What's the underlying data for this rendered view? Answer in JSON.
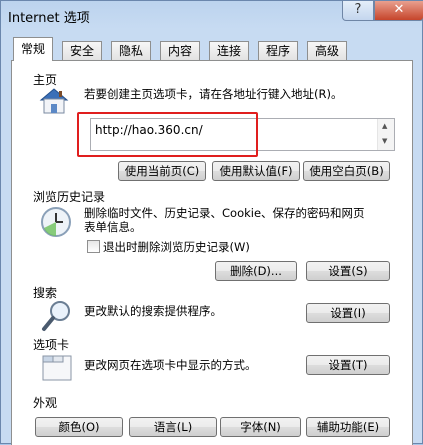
{
  "window": {
    "title": "Internet 选项",
    "help_label": "?",
    "close_label": "✕"
  },
  "tabs": [
    {
      "label": "常规",
      "active": true
    },
    {
      "label": "安全"
    },
    {
      "label": "隐私"
    },
    {
      "label": "内容"
    },
    {
      "label": "连接"
    },
    {
      "label": "程序"
    },
    {
      "label": "高级"
    }
  ],
  "homepage": {
    "title": "主页",
    "description": "若要创建主页选项卡，请在各地址行键入地址(R)。",
    "url_value": "http://hao.360.cn/",
    "use_current_label": "使用当前页(C)",
    "use_default_label": "使用默认值(F)",
    "use_blank_label": "使用空白页(B)"
  },
  "history": {
    "title": "浏览历史记录",
    "description_line1": "删除临时文件、历史记录、Cookie、保存的密码和网页",
    "description_line2": "表单信息。",
    "checkbox_label": "退出时删除浏览历史记录(W)",
    "delete_label": "删除(D)...",
    "settings_label": "设置(S)"
  },
  "search": {
    "title": "搜索",
    "description": "更改默认的搜索提供程序。",
    "settings_label": "设置(I)"
  },
  "tabs_section": {
    "title": "选项卡",
    "description": "更改网页在选项卡中显示的方式。",
    "settings_label": "设置(T)"
  },
  "appearance": {
    "title": "外观",
    "colors_label": "颜色(O)",
    "languages_label": "语言(L)",
    "fonts_label": "字体(N)",
    "accessibility_label": "辅助功能(E)"
  },
  "colors": {
    "highlight": "#e01e1e",
    "window_bg": "#c7dbf2"
  }
}
